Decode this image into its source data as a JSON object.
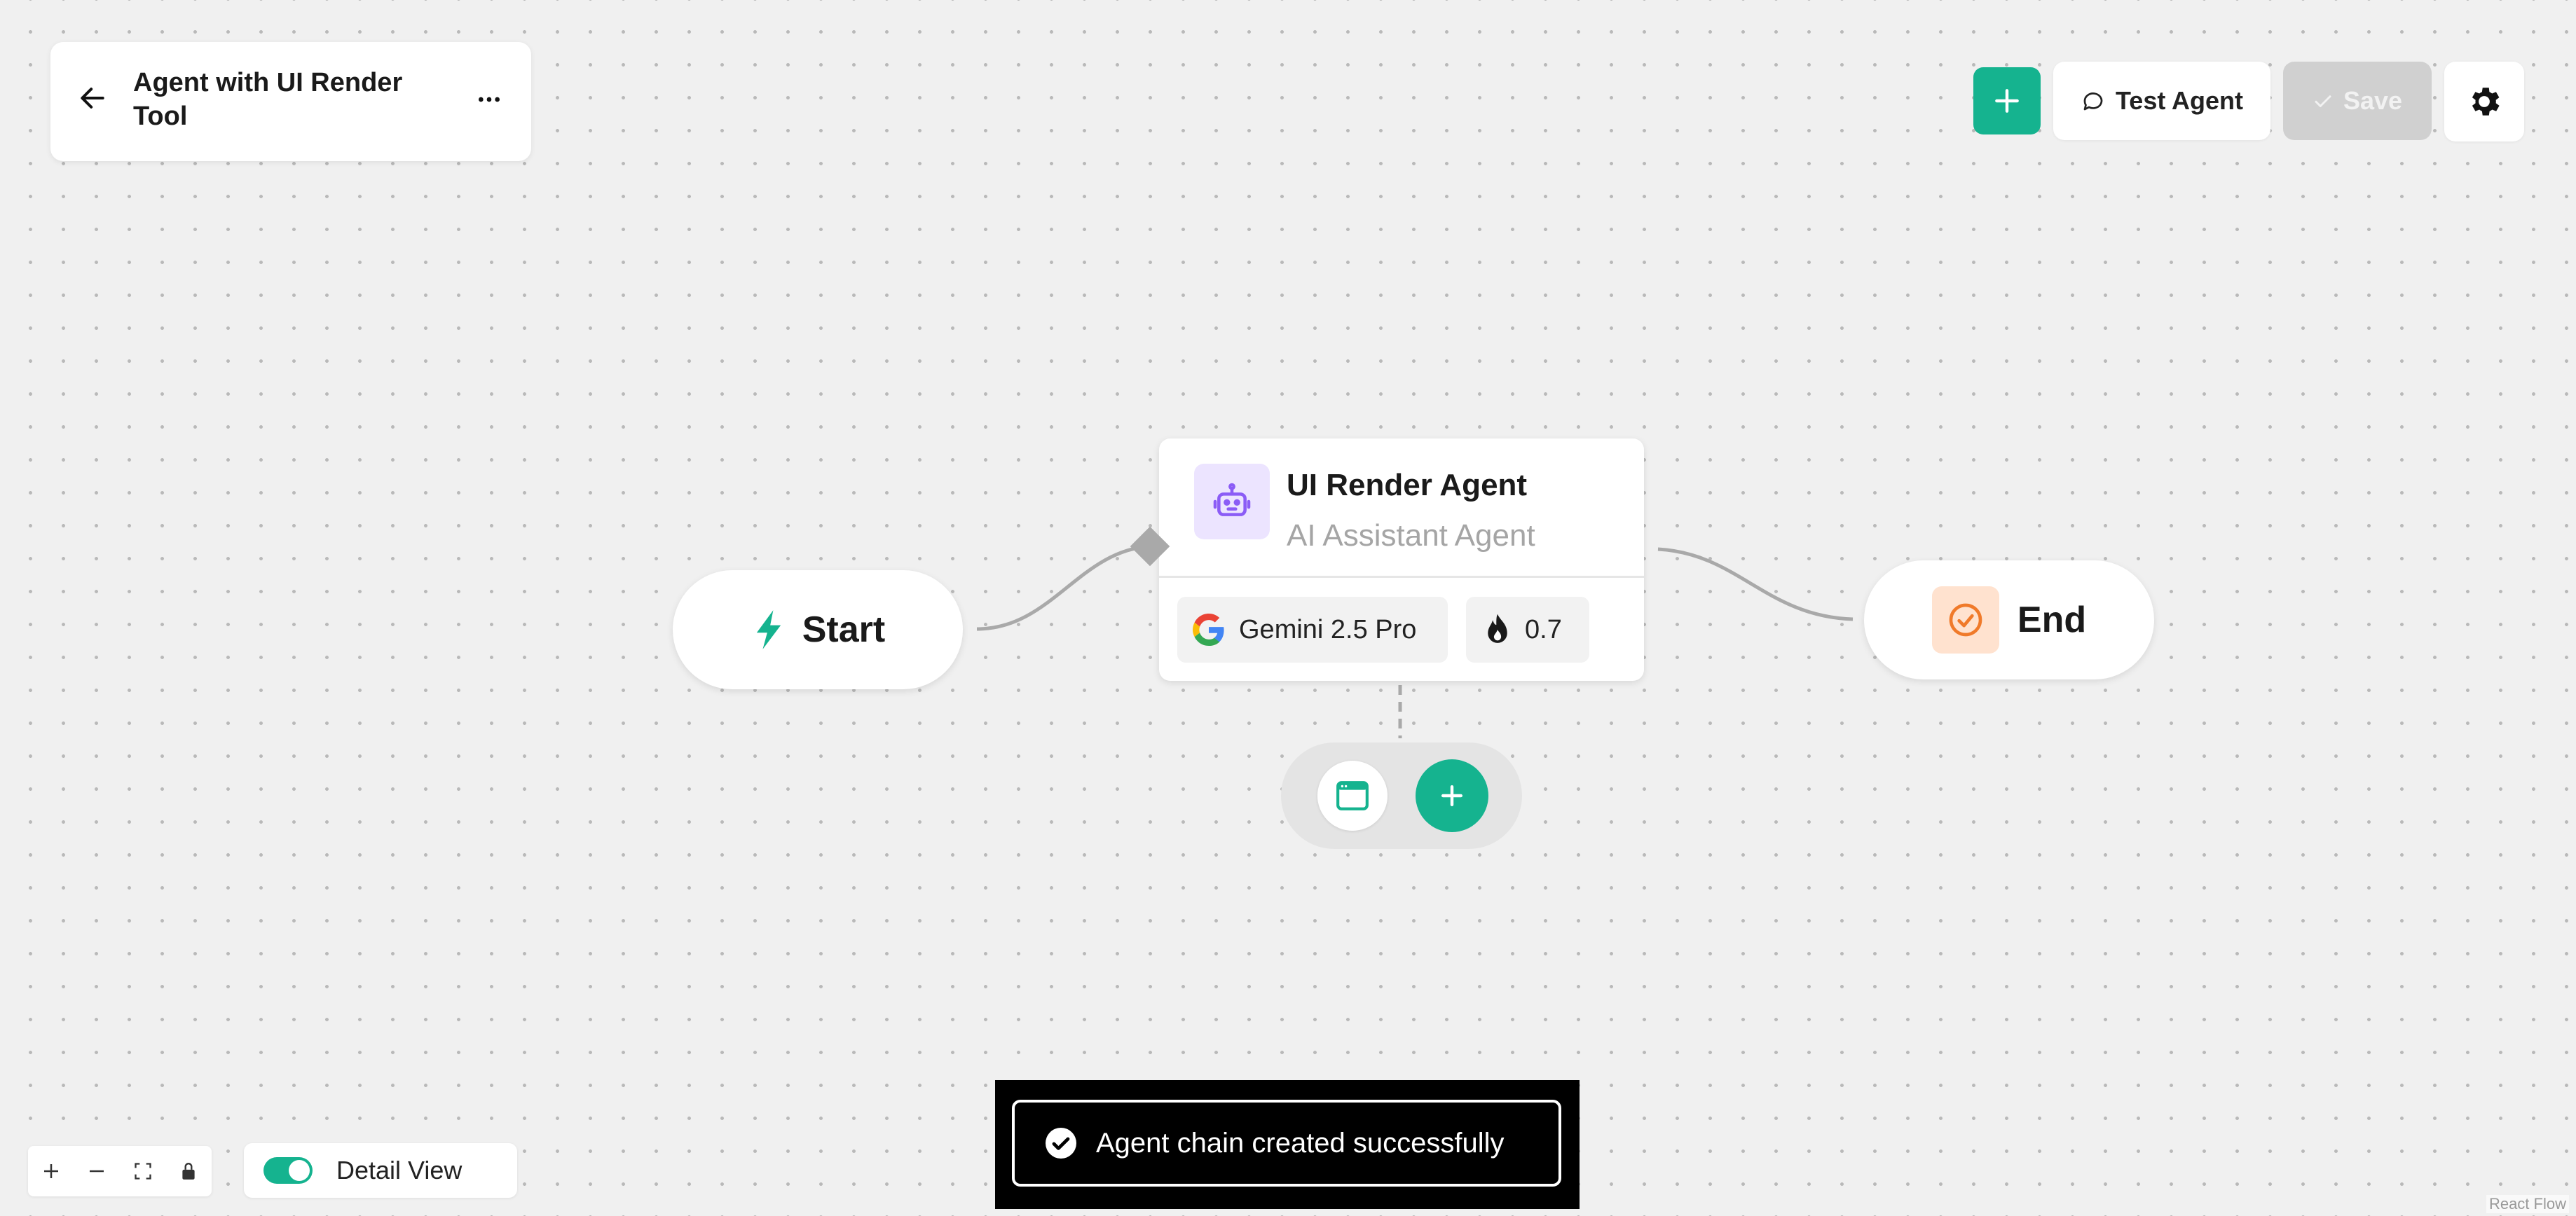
{
  "header": {
    "title": "Agent with UI Render Tool"
  },
  "toolbar": {
    "test_agent_label": "Test Agent",
    "save_label": "Save"
  },
  "nodes": {
    "start": {
      "label": "Start"
    },
    "agent": {
      "title": "UI Render Agent",
      "subtitle": "AI Assistant Agent",
      "model": "Gemini 2.5 Pro",
      "temperature": "0.7"
    },
    "end": {
      "label": "End"
    }
  },
  "controls": {
    "detail_view_label": "Detail View",
    "detail_view_enabled": true
  },
  "toast": {
    "message": "Agent chain created successfully"
  },
  "attribution": "React Flow",
  "colors": {
    "accent": "#15b38f",
    "agent_icon_bg": "#ece4ff",
    "end_icon_bg": "#ffe2cf",
    "end_icon": "#f07a2a"
  },
  "icons": {
    "back": "arrow-left-icon",
    "menu": "more-horizontal-icon",
    "add": "plus-icon",
    "chat": "chat-bubble-icon",
    "save": "check-icon",
    "settings": "gear-icon",
    "start": "lightning-icon",
    "agent": "robot-icon",
    "model": "google-logo-icon",
    "temperature": "flame-icon",
    "ui_tool": "browser-window-icon",
    "end": "check-circle-icon"
  }
}
